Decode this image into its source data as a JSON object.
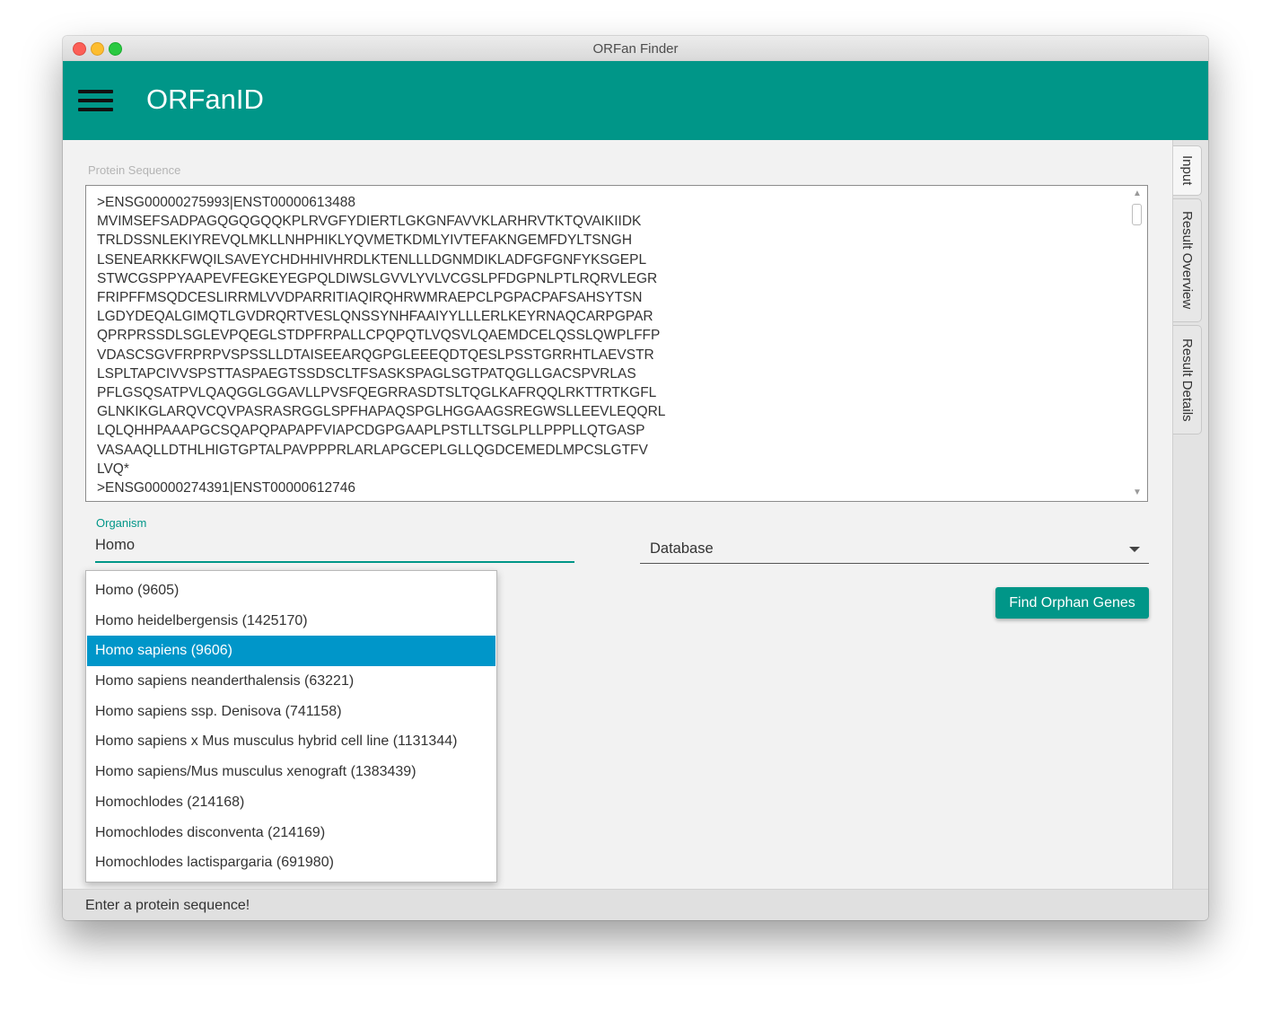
{
  "window": {
    "title": "ORFan Finder"
  },
  "appbar": {
    "title": "ORFanID",
    "menu_icon": "hamburger-menu-icon",
    "color": "#009688"
  },
  "sequence": {
    "label": "Protein Sequence",
    "text": ">ENSG00000275993|ENST00000613488\nMVIMSEFSADPAGQGQGQQKPLRVGFYDIERTLGKGNFAVVKLARHRVTKTQVAIKIIDK\nTRLDSSNLEKIYREVQLMKLLNHPHIKLYQVMETKDMLYIVTEFAKNGEMFDYLTSNGH\nLSENEARKKFWQILSAVEYCHDHHIVHRDLKTENLLLDGNMDIKLADFGFGNFYKSGEPL\nSTWCGSPPYAAPEVFEGKEYEGPQLDIWSLGVVLYVLVCGSLPFDGPNLPTLRQRVLEGR\nFRIPFFMSQDCESLIRRMLVVDPARRITIAQIRQHRWMRAEPCLPGPACPAFSAHSYTSN\nLGDYDEQALGIMQTLGVDRQRTVESLQNSSYNHFAAIYYLLLERLKEYRNAQCARPGPAR\nQPRPRSSDLSGLEVPQEGLSTDPFRPALLCPQPQTLVQSVLQAEMDCELQSSLQWPLFFP\nVDASCSGVFRPRPVSPSSLLDTAISEEARQGPGLEEEQDTQESLPSSTGRRHTLAEVSTR\nLSPLTAPCIVVSPSTTASPAEGTSSDSCLTFSASKSPAGLSGTPATQGLLGACSPVRLAS\nPFLGSQSATPVLQAQGGLGGAVLLPVSFQEGRRASDTSLTQGLKAFRQQLRKTTRTKGFL\nGLNKIKGLARQVCQVPASRASRGGLSPFHAPAQSPGLHGGAAGSREGWSLLEEVLEQQRL\nLQLQHHPAAAPGCSQAPQPAPAPFVIAPCDGPGAAPLPSTLLTSGLPLLPPPLLQTGASP\nVASAAQLLDTHLHIGTGPTALPAVPPPRLARLAPGCEPLGLLQGDCEMEDLMPCSLGTFV\nLVQ*\n>ENSG00000274391|ENST00000612746"
  },
  "organism": {
    "label": "Organism",
    "value": "Homo",
    "suggestions": [
      "Homo (9605)",
      "Homo heidelbergensis (1425170)",
      "Homo sapiens (9606)",
      "Homo sapiens neanderthalensis (63221)",
      "Homo sapiens ssp. Denisova (741158)",
      "Homo sapiens x Mus musculus hybrid cell line (1131344)",
      "Homo sapiens/Mus musculus xenograft (1383439)",
      "Homochlodes (214168)",
      "Homochlodes disconventa (214169)",
      "Homochlodes lactispargaria (691980)"
    ],
    "selected_index": 2,
    "selected_color": "#0096c9"
  },
  "database": {
    "label": "Database"
  },
  "actions": {
    "find_label": "Find Orphan Genes"
  },
  "side_tabs": {
    "input": "Input",
    "overview": "Result Overview",
    "details": "Result Details"
  },
  "status": {
    "text": "Enter a protein sequence!"
  }
}
